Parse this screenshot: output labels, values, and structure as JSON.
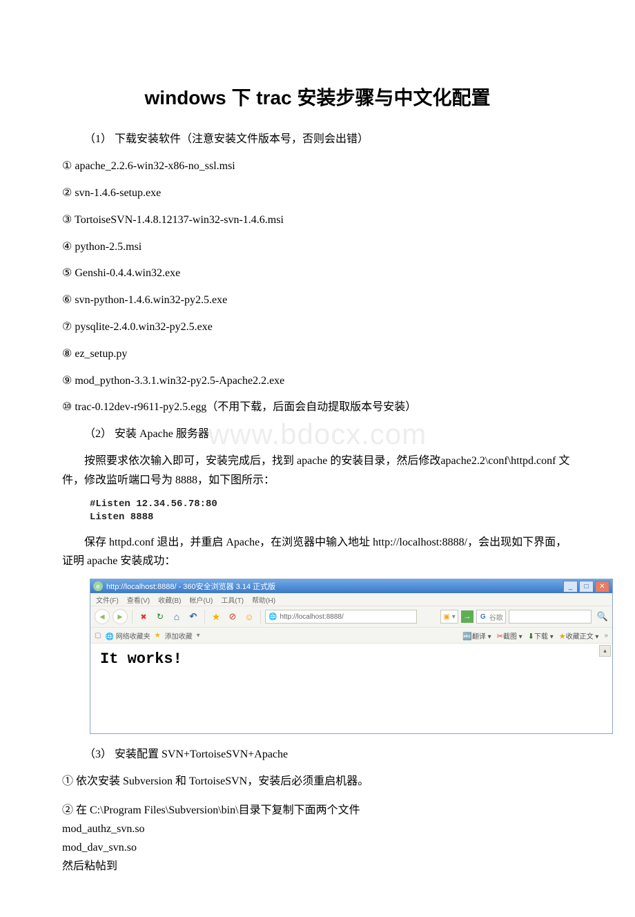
{
  "title": "windows 下 trac 安装步骤与中文化配置",
  "section1_heading": "（1）    下载安装软件（注意安装文件版本号，否则会出错）",
  "downloads": [
    "① apache_2.2.6-win32-x86-no_ssl.msi",
    "② svn-1.4.6-setup.exe",
    "③ TortoiseSVN-1.4.8.12137-win32-svn-1.4.6.msi",
    "④ python-2.5.msi",
    "⑤ Genshi-0.4.4.win32.exe",
    "⑥ svn-python-1.4.6.win32-py2.5.exe",
    "⑦ pysqlite-2.4.0.win32-py2.5.exe",
    "⑧ ez_setup.py",
    "⑨ mod_python-3.3.1.win32-py2.5-Apache2.2.exe",
    "⑩ trac-0.12dev-r9611-py2.5.egg（不用下载，后面会自动提取版本号安装）"
  ],
  "section2_heading": "（2）    安装 Apache 服务器",
  "section2_para1": "按照要求依次输入即可，安装完成后，找到 apache 的安装目录，然后修改apache2.2\\conf\\httpd.conf 文件，修改监听端口号为 8888，如下图所示：",
  "code_block": {
    "line1": "#Listen 12.34.56.78:80",
    "line2": "Listen 8888"
  },
  "section2_para2": "保存 httpd.conf 退出，并重启 Apache，在浏览器中输入地址 http://localhost:8888/，会出现如下界面，证明 apache 安装成功：",
  "browser": {
    "title": "http://localhost:8888/ - 360安全浏览器 3.14 正式版",
    "menus": [
      "文件(F)",
      "查看(V)",
      "收藏(B)",
      "帐户(U)",
      "工具(T)",
      "帮助(H)"
    ],
    "address": "http://localhost:8888/",
    "search_placeholder": "谷歌",
    "bookmark_left": {
      "net_fav": "网络收藏夹",
      "add_fav": "添加收藏"
    },
    "bookmark_right": [
      "翻译",
      "截图",
      "下载",
      "收藏正文"
    ],
    "content_text": "It works!",
    "win_btns": {
      "min": "_",
      "max": "□",
      "close": "✕"
    }
  },
  "watermark": "www.bdocx.com",
  "section3_heading": "（3）    安装配置 SVN+TortoiseSVN+Apache",
  "section3_item1": "① 依次安装 Subversion 和 TortoiseSVN，安装后必须重启机器。",
  "section3_item2_a": "② 在 C:\\Program Files\\Subversion\\bin\\目录下复制下面两个文件",
  "section3_item2_b": "mod_authz_svn.so",
  "section3_item2_c": "mod_dav_svn.so",
  "section3_item2_d": "然后粘帖到"
}
